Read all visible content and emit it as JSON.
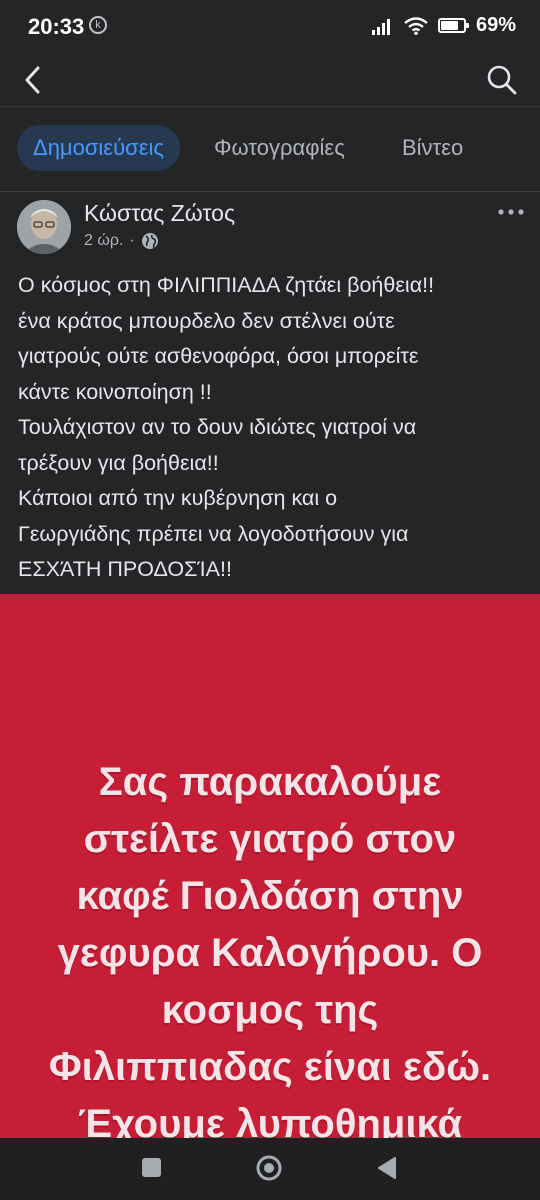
{
  "status": {
    "time": "20:33",
    "k_badge": "k",
    "battery": "69%"
  },
  "nav": {
    "back_icon": "back-arrow-icon",
    "search_icon": "search-icon"
  },
  "tabs": [
    {
      "label": "Δημοσιεύσεις",
      "active": true
    },
    {
      "label": "Φωτογραφίες",
      "active": false
    },
    {
      "label": "Βίντεο",
      "active": false
    }
  ],
  "post": {
    "author": "Κώστας Ζώτος",
    "time": "2 ώρ.",
    "separator": "·",
    "text": "Ο κόσμος στη ΦΙΛΙΠΠΙΑΔΑ ζητάει βοήθεια!!\nένα κράτος μπουρδελο δεν στέλνει ούτε\nγιατρούς ούτε ασθενοφόρα, όσοι μπορείτε\nκάντε κοινοποίηση !!\nΤουλάχιστον αν το δουν ιδιώτες γιατροί να\nτρέξουν για βοήθεια!!\nΚάποιοι από την κυβέρνηση και ο\nΓεωργιάδης πρέπει να λογοδοτήσουν για\nΕΣΧΆΤΗ ΠΡΟΔΟΣΊΑ!!",
    "image_text": "Σας παρακαλούμε\nστείλτε γιατρό στον\nκαφέ Γιολδάση στην\nγεφυρα Καλογήρου. Ο\nκοσμος της\nΦιλιππιαδας είναι εδώ.\nΈχουμε λυποθημικά",
    "image_bg_color": "#c51e36"
  },
  "colors": {
    "accent": "#4599ff",
    "background": "#242526"
  }
}
